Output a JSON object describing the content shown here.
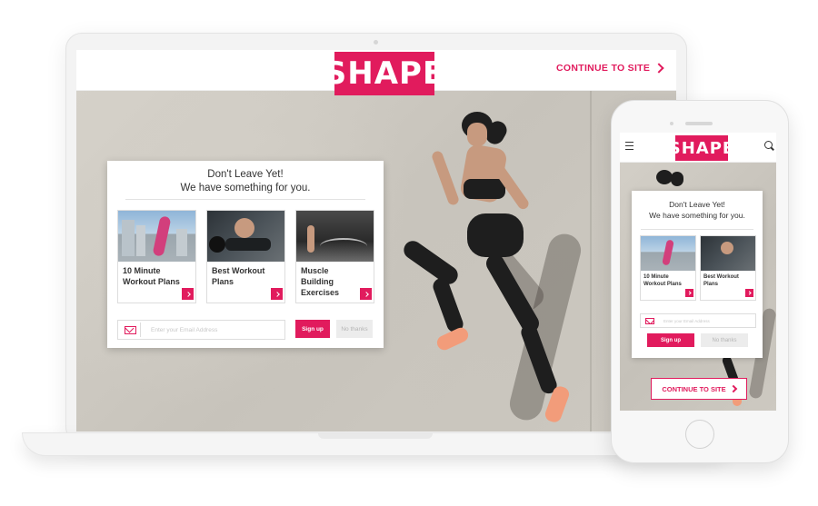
{
  "brand": {
    "logo_text": "SHAPE",
    "accent": "#e11b5d"
  },
  "desktop": {
    "continue_label": "CONTINUE TO SITE",
    "popup": {
      "title_line1": "Don't Leave Yet!",
      "title_line2": "We have something for you.",
      "cards": [
        {
          "title": "10 Minute Workout Plans"
        },
        {
          "title": "Best Workout Plans"
        },
        {
          "title": "Muscle Building Exercises"
        }
      ],
      "email_placeholder": "Enter your Email Address",
      "signup_label": "Sign up",
      "no_thanks_label": "No thanks"
    }
  },
  "mobile": {
    "popup": {
      "title_line1": "Don't Leave Yet!",
      "title_line2": "We have something for you.",
      "cards": [
        {
          "title": "10 Minute Workout Plans"
        },
        {
          "title": "Best Workout Plans"
        }
      ],
      "email_placeholder": "Enter your Email Address",
      "signup_label": "Sign up",
      "no_thanks_label": "No thanks"
    },
    "continue_label": "CONTINUE TO SITE"
  },
  "icons": [
    "menu-icon",
    "search-icon",
    "email-icon",
    "chevron-right-icon"
  ]
}
